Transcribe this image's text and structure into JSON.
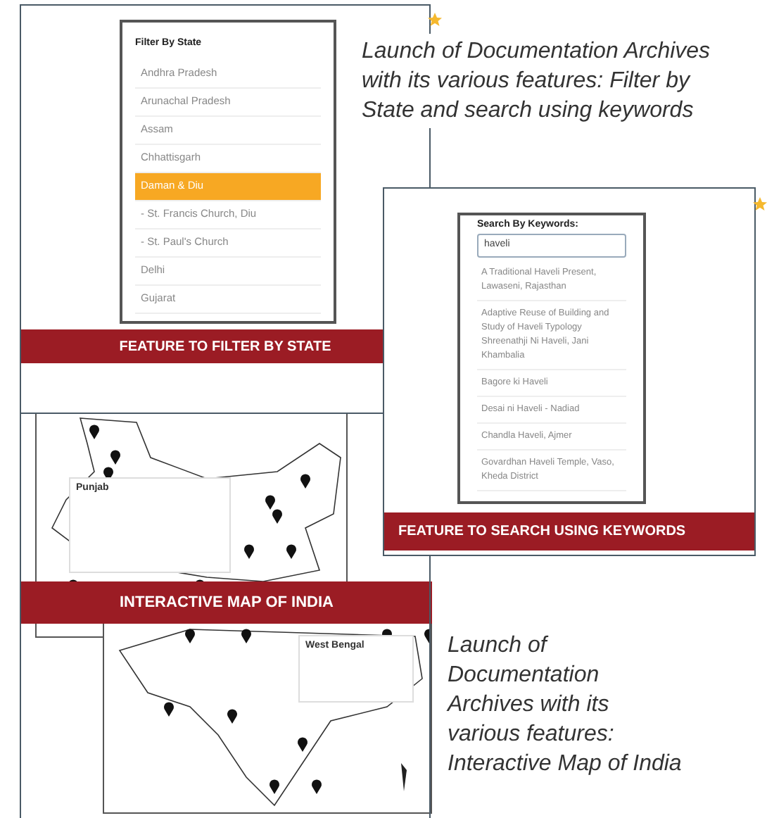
{
  "filter_panel": {
    "title": "Filter By State",
    "items": [
      {
        "label": "Andhra Pradesh",
        "selected": false
      },
      {
        "label": "Arunachal Pradesh",
        "selected": false
      },
      {
        "label": "Assam",
        "selected": false
      },
      {
        "label": "Chhattisgarh",
        "selected": false
      },
      {
        "label": "Daman & Diu",
        "selected": true
      },
      {
        "label": "- St. Francis Church, Diu",
        "selected": false
      },
      {
        "label": "- St. Paul's Church",
        "selected": false
      },
      {
        "label": "Delhi",
        "selected": false
      },
      {
        "label": "Gujarat",
        "selected": false
      }
    ],
    "banner": "FEATURE TO FILTER BY STATE"
  },
  "caption_1": "Launch of Documentation Archives with its various features: Filter by State and search using keywords",
  "search_panel": {
    "label": "Search By Keywords:",
    "value": "haveli",
    "results": [
      "A Traditional Haveli Present, Lawaseni, Rajasthan",
      "Adaptive Reuse of Building and Study of Haveli Typology Shreenathji Ni Haveli, Jani Khambalia",
      "Bagore ki Haveli",
      "Desai ni Haveli - Nadiad",
      "Chandla Haveli, Ajmer",
      "Govardhan Haveli Temple, Vaso, Kheda District"
    ],
    "banner": "FEATURE TO SEARCH USING KEYWORDS"
  },
  "map_panel": {
    "popups": [
      "Punjab",
      "West Bengal"
    ],
    "banner": "INTERACTIVE MAP OF INDIA"
  },
  "caption_2": "Launch of Documentation Archives with its various features: Interactive Map of India"
}
